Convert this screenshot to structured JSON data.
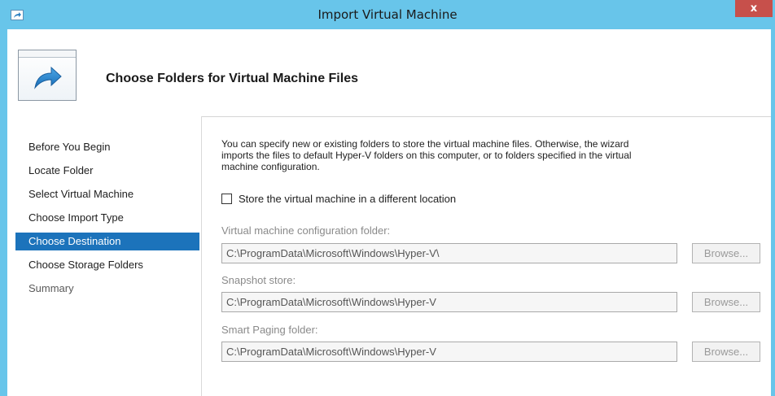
{
  "window": {
    "title": "Import Virtual Machine",
    "close_label": "x"
  },
  "header": {
    "title": "Choose Folders for Virtual Machine Files",
    "icon": "import-arrow-icon"
  },
  "nav": {
    "items": [
      {
        "label": "Before You Begin",
        "state": "normal"
      },
      {
        "label": "Locate Folder",
        "state": "normal"
      },
      {
        "label": "Select Virtual Machine",
        "state": "normal"
      },
      {
        "label": "Choose Import Type",
        "state": "normal"
      },
      {
        "label": "Choose Destination",
        "state": "selected"
      },
      {
        "label": "Choose Storage Folders",
        "state": "normal"
      },
      {
        "label": "Summary",
        "state": "disabled"
      }
    ]
  },
  "content": {
    "description_lines": [
      "You can specify new or existing folders to store the virtual machine files. Otherwise, the wizard",
      "imports the files to default Hyper-V folders on this computer, or to folders specified in the virtual",
      "machine configuration."
    ],
    "checkbox": {
      "label": "Store the virtual machine in a different location",
      "checked": false
    },
    "fields": [
      {
        "label": "Virtual machine configuration folder:",
        "value": "C:\\ProgramData\\Microsoft\\Windows\\Hyper-V\\",
        "button": "Browse..."
      },
      {
        "label": "Snapshot store:",
        "value": "C:\\ProgramData\\Microsoft\\Windows\\Hyper-V",
        "button": "Browse..."
      },
      {
        "label": "Smart Paging folder:",
        "value": "C:\\ProgramData\\Microsoft\\Windows\\Hyper-V",
        "button": "Browse..."
      }
    ]
  },
  "colors": {
    "titlebar": "#68c5ea",
    "close_button": "#c7504b",
    "selected_nav": "#1c73bb"
  }
}
